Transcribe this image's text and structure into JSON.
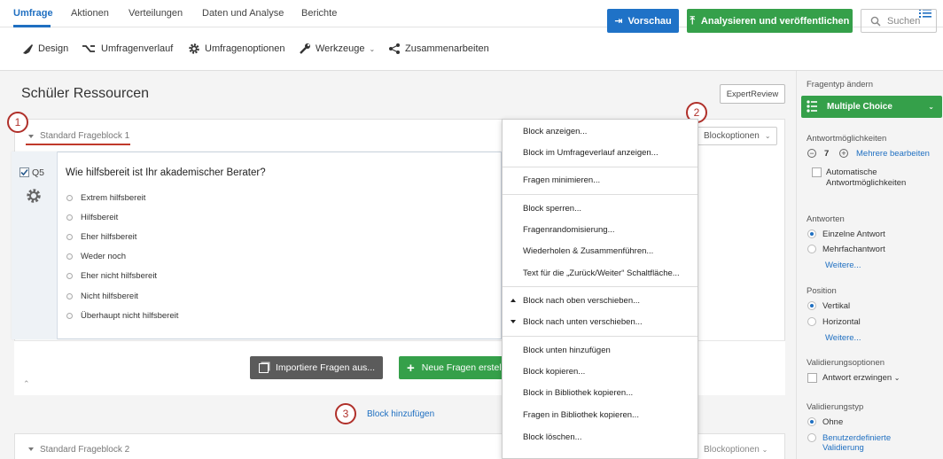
{
  "nav": {
    "tabs": [
      "Umfrage",
      "Aktionen",
      "Verteilungen",
      "Daten und Analyse",
      "Berichte"
    ]
  },
  "toolbar": {
    "design": "Design",
    "flow": "Umfragenverlauf",
    "options": "Umfragenoptionen",
    "tools": "Werkzeuge",
    "collab": "Zusammenarbeiten",
    "preview": "Vorschau",
    "publish": "Analysieren und veröffentlichen",
    "search_placeholder": "Suchen"
  },
  "survey": {
    "title": "Schüler Ressourcen",
    "expert_review": "ExpertReview"
  },
  "block1": {
    "label": "Standard Frageblock 1",
    "options_label": "Blockoptionen"
  },
  "question": {
    "number": "Q5",
    "text": "Wie hilfsbereit ist Ihr akademischer Berater?",
    "choices": [
      "Extrem hilfsbereit",
      "Hilfsbereit",
      "Eher hilfsbereit",
      "Weder noch",
      "Eher nicht hilfsbereit",
      "Nicht hilfsbereit",
      "Überhaupt nicht hilfsbereit"
    ]
  },
  "actions": {
    "import": "Importiere Fragen aus...",
    "new": "Neue Fragen erstellen",
    "add_block": "Block hinzufügen"
  },
  "block2": {
    "label": "Standard Frageblock 2",
    "options_label": "Blockoptionen"
  },
  "callouts": [
    "1",
    "2",
    "3"
  ],
  "menu": {
    "items": [
      "Block anzeigen...",
      "Block im Umfrageverlauf anzeigen...",
      "Fragen minimieren...",
      "Block sperren...",
      "Fragenrandomisierung...",
      "Wiederholen & Zusammenführen...",
      "Text für die „Zurück/Weiter“ Schaltfläche...",
      "Block nach oben verschieben...",
      "Block nach unten verschieben...",
      "Block unten hinzufügen",
      "Block kopieren...",
      "Block in Bibliothek kopieren...",
      "Fragen in Bibliothek kopieren...",
      "Block löschen..."
    ]
  },
  "panel": {
    "qtype_label": "Fragentyp ändern",
    "qtype_value": "Multiple Choice",
    "choices_label": "Antwortmöglichkeiten",
    "choices_count": "7",
    "edit_multiple": "Mehrere bearbeiten",
    "auto_choices": "Automatische",
    "auto_choices_2": "Antwortmöglichkeiten",
    "answers_label": "Antworten",
    "single": "Einzelne Antwort",
    "multi": "Mehrfachantwort",
    "more1": "Weitere...",
    "position_label": "Position",
    "vertical": "Vertikal",
    "horizontal": "Horizontal",
    "more2": "Weitere...",
    "validation_opts_label": "Validierungsoptionen",
    "force": "Antwort erzwingen",
    "validation_type_label": "Validierungstyp",
    "none": "Ohne",
    "custom": "Benutzerdefinierte",
    "custom_2": "Validierung"
  },
  "colors": {
    "accent": "#1f6fc1",
    "green": "#35a04a",
    "callout": "#b0302a"
  }
}
